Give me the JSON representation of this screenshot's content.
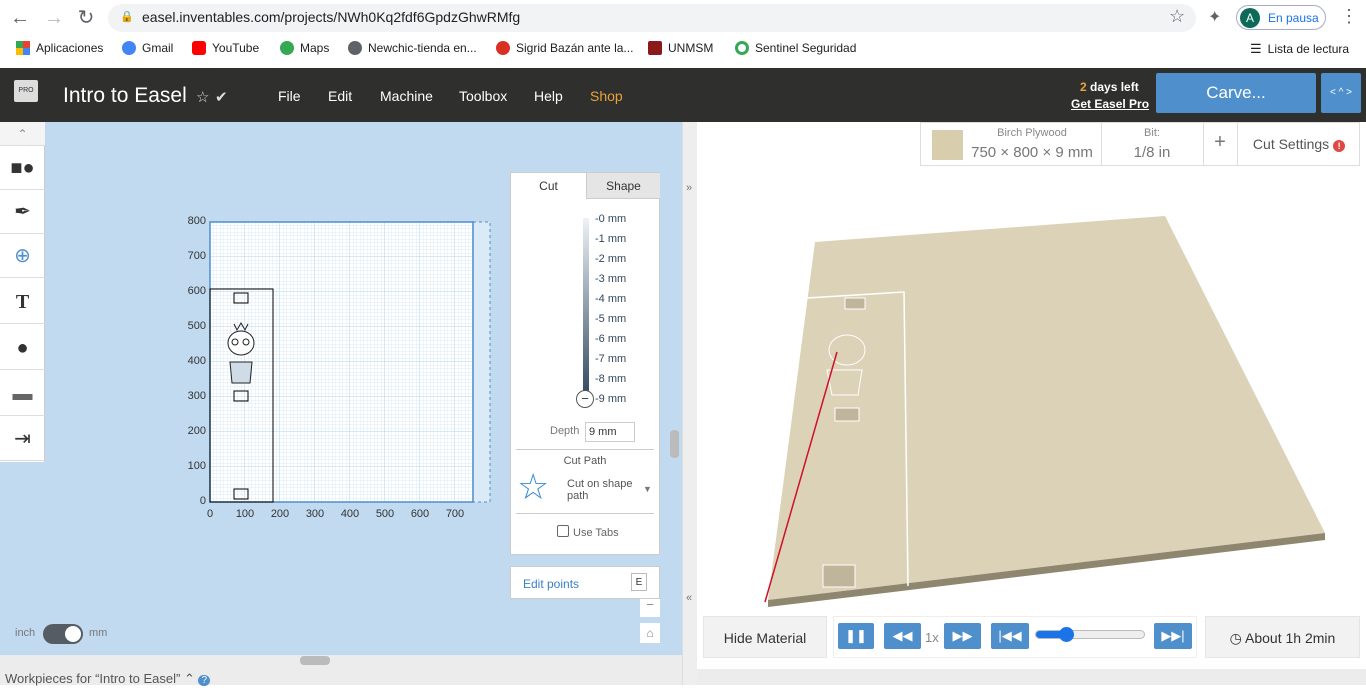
{
  "browser": {
    "url": "easel.inventables.com/projects/NWh0Kq2fdf6GpdzGhwRMfg",
    "profile_initial": "A",
    "profile_status": "En pausa",
    "reading_list": "Lista de lectura",
    "bookmarks": [
      {
        "label": "Aplicaciones",
        "color": "#e94235"
      },
      {
        "label": "Gmail",
        "color": "#4285f4"
      },
      {
        "label": "YouTube",
        "color": "#ff0000"
      },
      {
        "label": "Maps",
        "color": "#34a853"
      },
      {
        "label": "Newchic-tienda en...",
        "color": "#5f6368"
      },
      {
        "label": "Sigrid Bazán ante la...",
        "color": "#d93025"
      },
      {
        "label": "UNMSM",
        "color": "#8b1a1a"
      },
      {
        "label": "Sentinel Seguridad",
        "color": "#34a853"
      }
    ]
  },
  "app": {
    "logo": "PRO",
    "title": "Intro to Easel",
    "menu": [
      "File",
      "Edit",
      "Machine",
      "Toolbox",
      "Help",
      "Shop"
    ],
    "trial_days": "2",
    "trial_text": "days left",
    "get_pro": "Get Easel Pro",
    "carve": "Carve..."
  },
  "material": {
    "name": "Birch Plywood",
    "size": "750 × 800 × 9 mm",
    "bit_label": "Bit:",
    "bit": "1/8 in",
    "add": "+",
    "cut_settings": "Cut Settings"
  },
  "canvas": {
    "x_ticks": [
      "0",
      "100",
      "200",
      "300",
      "400",
      "500",
      "600",
      "700"
    ],
    "y_ticks": [
      "800",
      "700",
      "600",
      "500",
      "400",
      "300",
      "200",
      "100",
      "0"
    ],
    "unit_inch": "inch",
    "unit_mm": "mm"
  },
  "panel": {
    "tab_cut": "Cut",
    "tab_shape": "Shape",
    "depths": [
      "-0 mm",
      "-1 mm",
      "-2 mm",
      "-3 mm",
      "-4 mm",
      "-5 mm",
      "-6 mm",
      "-7 mm",
      "-8 mm",
      "-9 mm"
    ],
    "depth_label": "Depth",
    "depth_value": "9 mm",
    "cut_path_label": "Cut Path",
    "cut_path_value": "Cut on shape path",
    "use_tabs": "Use Tabs",
    "edit_points": "Edit points",
    "edit_key": "E"
  },
  "preview": {
    "hide_material": "Hide Material",
    "speed": "1x",
    "time": "About 1h 2min",
    "progress": 0.28
  },
  "footer": {
    "workpieces": "Workpieces for “Intro to Easel”"
  }
}
